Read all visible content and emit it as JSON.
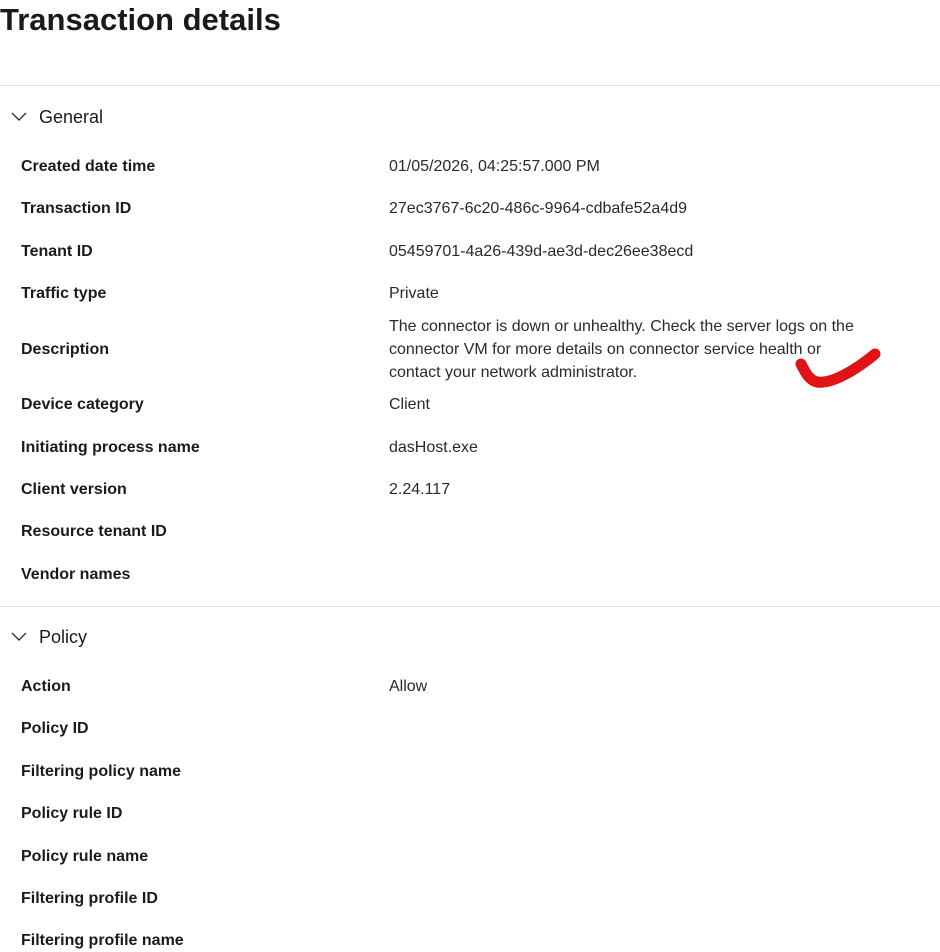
{
  "page": {
    "title": "Transaction details"
  },
  "sections": [
    {
      "title": "General",
      "icon": "chevron-down-icon",
      "rows": [
        {
          "label": "Created date time",
          "value": "01/05/2026, 04:25:57.000 PM"
        },
        {
          "label": "Transaction ID",
          "value": "27ec3767-6c20-486c-9964-cdbafe52a4d9"
        },
        {
          "label": "Tenant ID",
          "value": "05459701-4a26-439d-ae3d-dec26ee38ecd"
        },
        {
          "label": "Traffic type",
          "value": "Private"
        },
        {
          "label": "Description",
          "value": "The connector is down or unhealthy. Check the server logs on the connector VM for more details on connector service health or contact your network administrator."
        },
        {
          "label": "Device category",
          "value": "Client"
        },
        {
          "label": "Initiating process name",
          "value": "dasHost.exe"
        },
        {
          "label": "Client version",
          "value": "2.24.117"
        },
        {
          "label": "Resource tenant ID",
          "value": ""
        },
        {
          "label": "Vendor names",
          "value": ""
        }
      ]
    },
    {
      "title": "Policy",
      "icon": "chevron-down-icon",
      "rows": [
        {
          "label": "Action",
          "value": "Allow"
        },
        {
          "label": "Policy ID",
          "value": ""
        },
        {
          "label": "Filtering policy name",
          "value": ""
        },
        {
          "label": "Policy rule ID",
          "value": ""
        },
        {
          "label": "Policy rule name",
          "value": ""
        },
        {
          "label": "Filtering profile ID",
          "value": ""
        },
        {
          "label": "Filtering profile name",
          "value": ""
        }
      ]
    }
  ],
  "annotation": {
    "icon": "red-checkmark-annotation",
    "color": "#e01414"
  }
}
